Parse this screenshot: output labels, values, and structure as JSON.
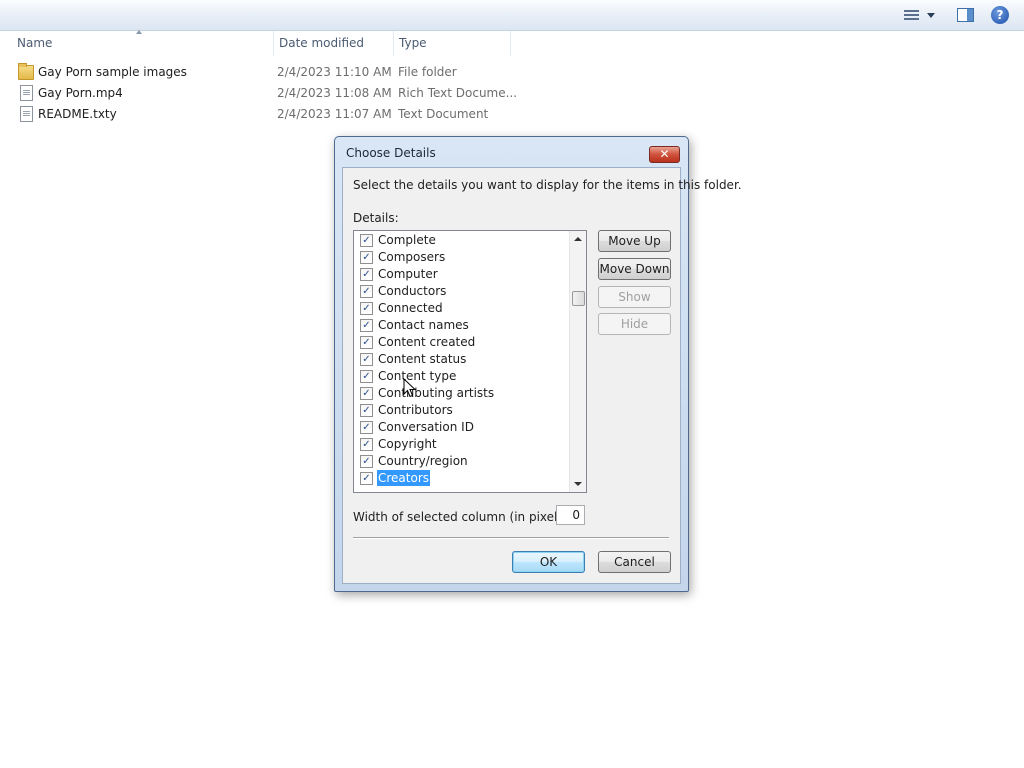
{
  "toolbar": {
    "views_icon": "views-icon",
    "preview_icon": "preview-pane-icon",
    "help_icon": "help-icon",
    "help_glyph": "?"
  },
  "columns": {
    "name": "Name",
    "date_modified": "Date modified",
    "type": "Type"
  },
  "files": [
    {
      "name": "Gay Porn sample images",
      "date": "2/4/2023 11:10 AM",
      "type": "File folder",
      "icon": "folder-icon"
    },
    {
      "name": "Gay Porn.mp4",
      "date": "2/4/2023 11:08 AM",
      "type": "Rich Text Docume...",
      "icon": "document-icon"
    },
    {
      "name": "README.txty",
      "date": "2/4/2023 11:07 AM",
      "type": "Text Document",
      "icon": "document-icon"
    }
  ],
  "dialog": {
    "title": "Choose Details",
    "close_glyph": "✕",
    "intro": "Select the details you want to display for the items in this folder.",
    "details_label": "Details:",
    "items": [
      {
        "label": "Complete",
        "checked": true
      },
      {
        "label": "Composers",
        "checked": true
      },
      {
        "label": "Computer",
        "checked": true
      },
      {
        "label": "Conductors",
        "checked": true
      },
      {
        "label": "Connected",
        "checked": true
      },
      {
        "label": "Contact names",
        "checked": true
      },
      {
        "label": "Content created",
        "checked": true
      },
      {
        "label": "Content status",
        "checked": true
      },
      {
        "label": "Content type",
        "checked": true
      },
      {
        "label": "Contributing artists",
        "checked": true
      },
      {
        "label": "Contributors",
        "checked": true
      },
      {
        "label": "Conversation ID",
        "checked": true
      },
      {
        "label": "Copyright",
        "checked": true
      },
      {
        "label": "Country/region",
        "checked": true
      },
      {
        "label": "Creators",
        "checked": true,
        "selected": true
      }
    ],
    "check_glyph": "✓",
    "buttons": {
      "move_up": "Move Up",
      "move_down": "Move Down",
      "show": "Show",
      "hide": "Hide",
      "ok": "OK",
      "cancel": "Cancel"
    },
    "width_label": "Width of selected column (in pixels):",
    "width_value": "0"
  },
  "colors": {
    "selection": "#3399ff",
    "close_button": "#c9432c"
  }
}
